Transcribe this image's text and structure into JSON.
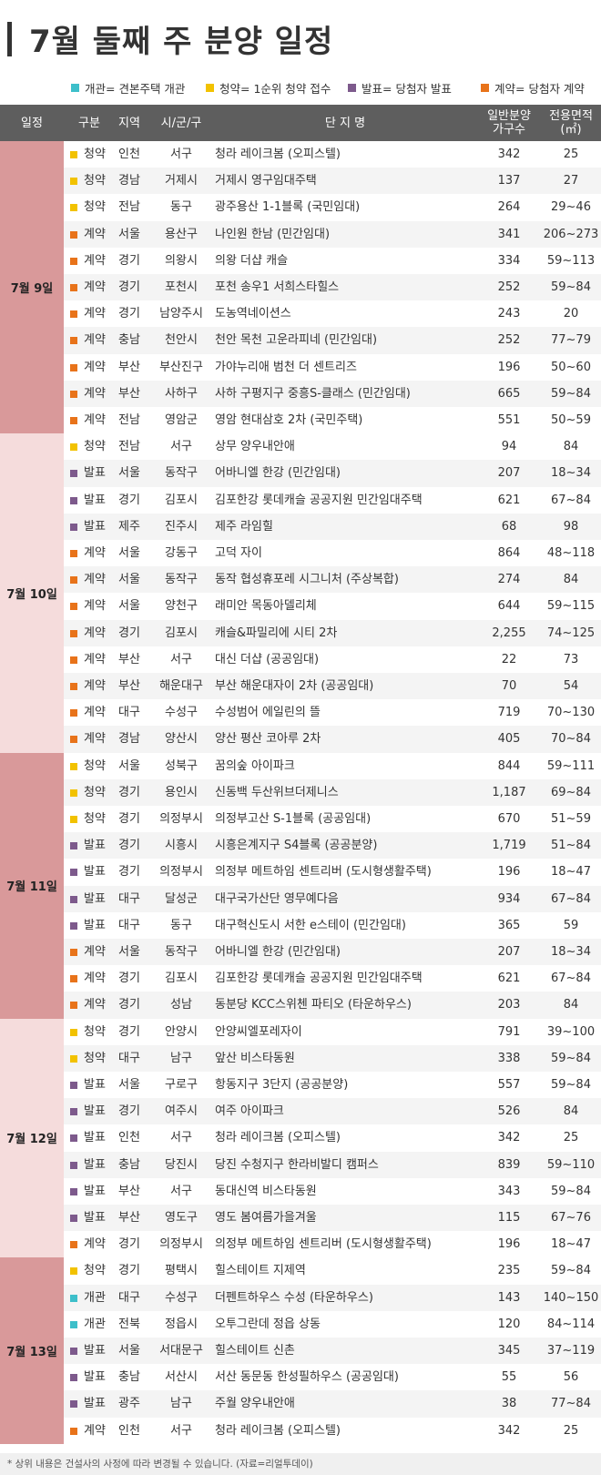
{
  "title": "7월 둘째 주 분양 일정",
  "legend": [
    {
      "label": "개관= 견본주택 개관",
      "color": "#3dbfca"
    },
    {
      "label": "청약= 1순위 청약 접수",
      "color": "#f2c200"
    },
    {
      "label": "발표= 당첨자 발표",
      "color": "#7d5a8c"
    },
    {
      "label": "계약= 당첨자 계약",
      "color": "#e8731a"
    }
  ],
  "colors": {
    "개관": "#3dbfca",
    "청약": "#f2c200",
    "발표": "#7d5a8c",
    "계약": "#e8731a",
    "group_dark": "#d9999a",
    "group_light": "#f5dcdc"
  },
  "header": {
    "date": "일정",
    "type": "구분",
    "region": "지역",
    "city": "시/군/구",
    "complex": "단 지 명",
    "units_line1": "일반분양",
    "units_line2": "가구수",
    "area_line1": "전용면적",
    "area_line2": "(㎡)"
  },
  "groups": [
    {
      "date": "7월 9일",
      "rows": [
        [
          "청약",
          "인천",
          "서구",
          "청라 레이크봄 (오피스텔)",
          "342",
          "25"
        ],
        [
          "청약",
          "경남",
          "거제시",
          "거제시 영구임대주택",
          "137",
          "27"
        ],
        [
          "청약",
          "전남",
          "동구",
          "광주용산 1-1블록 (국민임대)",
          "264",
          "29~46"
        ],
        [
          "계약",
          "서울",
          "용산구",
          "나인원 한남 (민간임대)",
          "341",
          "206~273"
        ],
        [
          "계약",
          "경기",
          "의왕시",
          "의왕 더샵 캐슬",
          "334",
          "59~113"
        ],
        [
          "계약",
          "경기",
          "포천시",
          "포천 송우1 서희스타힐스",
          "252",
          "59~84"
        ],
        [
          "계약",
          "경기",
          "남양주시",
          "도농역네이션스",
          "243",
          "20"
        ],
        [
          "계약",
          "충남",
          "천안시",
          "천안 목천 고운라피네 (민간임대)",
          "252",
          "77~79"
        ],
        [
          "계약",
          "부산",
          "부산진구",
          "가야누리애 범천 더 센트리즈",
          "196",
          "50~60"
        ],
        [
          "계약",
          "부산",
          "사하구",
          "사하 구평지구 중흥S-클래스 (민간임대)",
          "665",
          "59~84"
        ],
        [
          "계약",
          "전남",
          "영암군",
          "영암 현대삼호 2차 (국민주택)",
          "551",
          "50~59"
        ]
      ]
    },
    {
      "date": "7월 10일",
      "rows": [
        [
          "청약",
          "전남",
          "서구",
          "상무 양우내안애",
          "94",
          "84"
        ],
        [
          "발표",
          "서울",
          "동작구",
          "어바니엘 한강 (민간임대)",
          "207",
          "18~34"
        ],
        [
          "발표",
          "경기",
          "김포시",
          "김포한강 롯데캐슬 공공지원 민간임대주택",
          "621",
          "67~84"
        ],
        [
          "발표",
          "제주",
          "진주시",
          "제주 라임힐",
          "68",
          "98"
        ],
        [
          "계약",
          "서울",
          "강동구",
          "고덕 자이",
          "864",
          "48~118"
        ],
        [
          "계약",
          "서울",
          "동작구",
          "동작 협성휴포레 시그니처 (주상복합)",
          "274",
          "84"
        ],
        [
          "계약",
          "서울",
          "양천구",
          "래미안 목동아델리체",
          "644",
          "59~115"
        ],
        [
          "계약",
          "경기",
          "김포시",
          "캐슬&파밀리에 시티 2차",
          "2,255",
          "74~125"
        ],
        [
          "계약",
          "부산",
          "서구",
          "대신 더샵 (공공임대)",
          "22",
          "73"
        ],
        [
          "계약",
          "부산",
          "해운대구",
          "부산 해운대자이 2차 (공공임대)",
          "70",
          "54"
        ],
        [
          "계약",
          "대구",
          "수성구",
          "수성범어 에일린의 뜰",
          "719",
          "70~130"
        ],
        [
          "계약",
          "경남",
          "양산시",
          "양산 평산 코아루 2차",
          "405",
          "70~84"
        ]
      ]
    },
    {
      "date": "7월 11일",
      "rows": [
        [
          "청약",
          "서울",
          "성북구",
          "꿈의숲 아이파크",
          "844",
          "59~111"
        ],
        [
          "청약",
          "경기",
          "용인시",
          "신동백 두산위브더제니스",
          "1,187",
          "69~84"
        ],
        [
          "청약",
          "경기",
          "의정부시",
          "의정부고산 S-1블록 (공공임대)",
          "670",
          "51~59"
        ],
        [
          "발표",
          "경기",
          "시흥시",
          "시흥은계지구 S4블록 (공공분양)",
          "1,719",
          "51~84"
        ],
        [
          "발표",
          "경기",
          "의정부시",
          "의정부 메트하임 센트리버 (도시형생활주택)",
          "196",
          "18~47"
        ],
        [
          "발표",
          "대구",
          "달성군",
          "대구국가산단 영무예다음",
          "934",
          "67~84"
        ],
        [
          "발표",
          "대구",
          "동구",
          "대구혁신도시 서한 e스테이 (민간임대)",
          "365",
          "59"
        ],
        [
          "계약",
          "서울",
          "동작구",
          "어바니엘 한강 (민간임대)",
          "207",
          "18~34"
        ],
        [
          "계약",
          "경기",
          "김포시",
          "김포한강 롯데캐슬 공공지원 민간임대주택",
          "621",
          "67~84"
        ],
        [
          "계약",
          "경기",
          "성남",
          "동분당 KCC스위첸 파티오 (타운하우스)",
          "203",
          "84"
        ]
      ]
    },
    {
      "date": "7월 12일",
      "rows": [
        [
          "청약",
          "경기",
          "안양시",
          "안양씨엘포레자이",
          "791",
          "39~100"
        ],
        [
          "청약",
          "대구",
          "남구",
          "앞산 비스타동원",
          "338",
          "59~84"
        ],
        [
          "발표",
          "서울",
          "구로구",
          "항동지구 3단지 (공공분양)",
          "557",
          "59~84"
        ],
        [
          "발표",
          "경기",
          "여주시",
          "여주 아이파크",
          "526",
          "84"
        ],
        [
          "발표",
          "인천",
          "서구",
          "청라 레이크봄 (오피스텔)",
          "342",
          "25"
        ],
        [
          "발표",
          "충남",
          "당진시",
          "당진 수청지구 한라비발디 캠퍼스",
          "839",
          "59~110"
        ],
        [
          "발표",
          "부산",
          "서구",
          "동대신역 비스타동원",
          "343",
          "59~84"
        ],
        [
          "발표",
          "부산",
          "영도구",
          "영도 봄여름가을겨울",
          "115",
          "67~76"
        ],
        [
          "계약",
          "경기",
          "의정부시",
          "의정부 메트하임 센트리버 (도시형생활주택)",
          "196",
          "18~47"
        ]
      ]
    },
    {
      "date": "7월 13일",
      "rows": [
        [
          "청약",
          "경기",
          "평택시",
          "힐스테이트 지제역",
          "235",
          "59~84"
        ],
        [
          "개관",
          "대구",
          "수성구",
          "더펜트하우스 수성 (타운하우스)",
          "143",
          "140~150"
        ],
        [
          "개관",
          "전북",
          "정읍시",
          "오투그란데 정읍 상동",
          "120",
          "84~114"
        ],
        [
          "발표",
          "서울",
          "서대문구",
          "힐스테이트 신촌",
          "345",
          "37~119"
        ],
        [
          "발표",
          "충남",
          "서산시",
          "서산 동문동 한성필하우스 (공공임대)",
          "55",
          "56"
        ],
        [
          "발표",
          "광주",
          "남구",
          "주월 양우내안애",
          "38",
          "77~84"
        ],
        [
          "계약",
          "인천",
          "서구",
          "청라 레이크봄 (오피스텔)",
          "342",
          "25"
        ]
      ]
    }
  ],
  "footnote": "* 상위 내용은 건설사의 사정에 따라 변경될 수 있습니다. (자료=리얼투데이)"
}
